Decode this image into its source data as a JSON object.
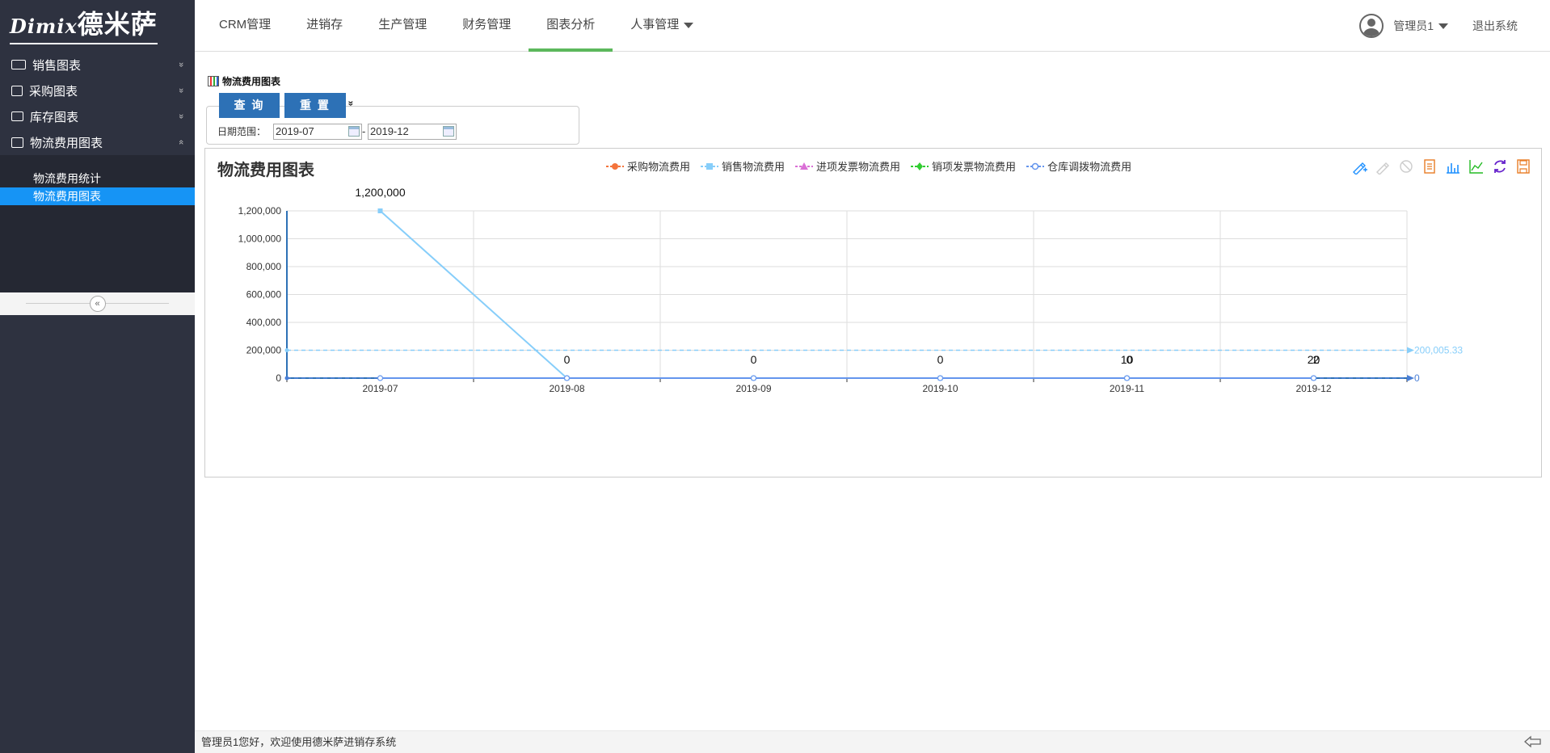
{
  "app": {
    "logo_en": "Dimix",
    "logo_cn": "德米萨"
  },
  "sidebar": {
    "items": [
      {
        "label": "销售图表",
        "icon": "sales-chart-icon",
        "chevron": "»"
      },
      {
        "label": "采购图表",
        "icon": "edit-icon",
        "chevron": "»"
      },
      {
        "label": "库存图表",
        "icon": "inventory-icon",
        "chevron": "»"
      },
      {
        "label": "物流费用图表",
        "icon": "logistics-icon",
        "chevron": "«"
      }
    ],
    "subitems": [
      {
        "label": "物流费用统计",
        "active": false
      },
      {
        "label": "物流费用图表",
        "active": true
      }
    ],
    "collapse_glyph": "«"
  },
  "topnav": {
    "items": [
      {
        "label": "CRM管理"
      },
      {
        "label": "进销存"
      },
      {
        "label": "生产管理"
      },
      {
        "label": "财务管理"
      },
      {
        "label": "图表分析",
        "active": true
      },
      {
        "label": "人事管理"
      }
    ],
    "user": "管理员1",
    "logout": "退出系统"
  },
  "panel": {
    "title": "物流费用图表",
    "query_label": "查 询",
    "reset_label": "重 置",
    "expand_glyph": "»",
    "date_label": "日期范围：",
    "date_from": "2019-07",
    "date_sep": "-",
    "date_to": "2019-12"
  },
  "status": {
    "text": "管理员1您好，欢迎使用德米萨进销存系统"
  },
  "colors": {
    "accent": "#2d71b6",
    "sidebar_bg": "#2e3240",
    "active_sub": "#1694f5",
    "nav_underline": "#5cb85c"
  },
  "chart_data": {
    "type": "line",
    "title": "物流费用图表",
    "categories": [
      "2019-07",
      "2019-08",
      "2019-09",
      "2019-10",
      "2019-11",
      "2019-12"
    ],
    "ylim": [
      0,
      1200000
    ],
    "yticks": [
      0,
      200000,
      400000,
      600000,
      800000,
      1000000,
      1200000
    ],
    "ytick_labels": [
      "0",
      "200,000",
      "400,000",
      "600,000",
      "800,000",
      "1,000,000",
      "1,200,000"
    ],
    "grid": true,
    "legend_position": "top-center",
    "series": [
      {
        "name": "采购物流费用",
        "color": "#f4743c",
        "marker": "circle",
        "values": [
          0,
          0,
          0,
          0,
          10,
          20
        ]
      },
      {
        "name": "销售物流费用",
        "color": "#87cefa",
        "marker": "square",
        "values": [
          1200000,
          0,
          0,
          0,
          0,
          2
        ]
      },
      {
        "name": "进项发票物流费用",
        "color": "#da70d6",
        "marker": "triangle",
        "values": [
          0,
          0,
          0,
          0,
          0,
          0
        ]
      },
      {
        "name": "销项发票物流费用",
        "color": "#32cd32",
        "marker": "diamond",
        "values": [
          0,
          0,
          0,
          0,
          0,
          0
        ]
      },
      {
        "name": "仓库调拨物流费用",
        "color": "#6495ed",
        "marker": "emptycircle",
        "values": [
          0,
          0,
          0,
          0,
          0,
          0
        ]
      }
    ],
    "data_labels": [
      "1,200,000",
      "0",
      "0",
      "0",
      "10",
      "20"
    ],
    "data_labels_secondary": [
      "",
      "",
      "",
      "",
      "0",
      "2"
    ],
    "mark_lines": [
      {
        "series": "销售物流费用",
        "label": "200,005.33",
        "value": 200005.33,
        "color": "#87cefa"
      },
      {
        "series": "仓库调拨物流费用",
        "label": "0",
        "value": 0,
        "color": "#4a7fd6"
      }
    ]
  }
}
